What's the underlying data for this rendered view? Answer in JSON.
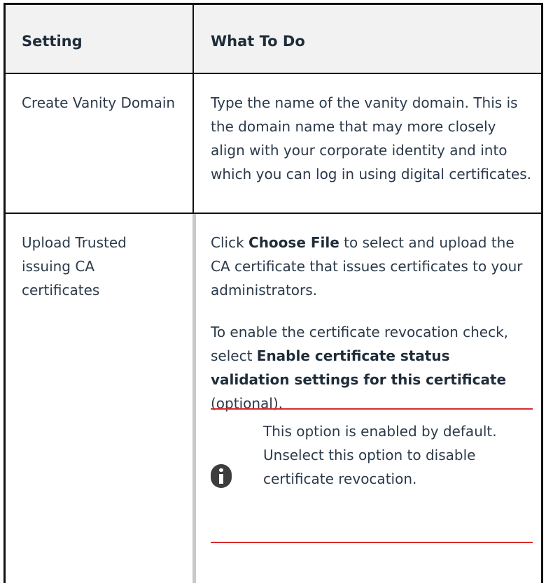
{
  "table": {
    "headers": {
      "setting": "Setting",
      "what_to_do": "What To Do"
    },
    "rows": [
      {
        "setting": "Create Vanity Domain",
        "what_to_do": "Type the name of the vanity domain. This is the domain name that may more closely align with your corporate identity and into which you can log in using digital certificates."
      },
      {
        "setting": "Upload Trusted issuing CA certificates",
        "para1": {
          "before": "Click ",
          "bold": "Choose File",
          "after": " to select and upload the CA certificate that issues certificates to your administrators."
        },
        "para2": {
          "before": "To enable the certificate revocation check, select ",
          "bold": "Enable certificate status validation settings for this certificate",
          "after": " (optional)."
        },
        "note": {
          "icon": "info-icon",
          "text": "This option is enabled by default. Unselect this option to disable certificate revocation."
        }
      }
    ]
  },
  "colors": {
    "border": "#111111",
    "header_bg": "#f2f2f2",
    "note_border": "#d92b2b",
    "text": "#2b3a4a"
  }
}
